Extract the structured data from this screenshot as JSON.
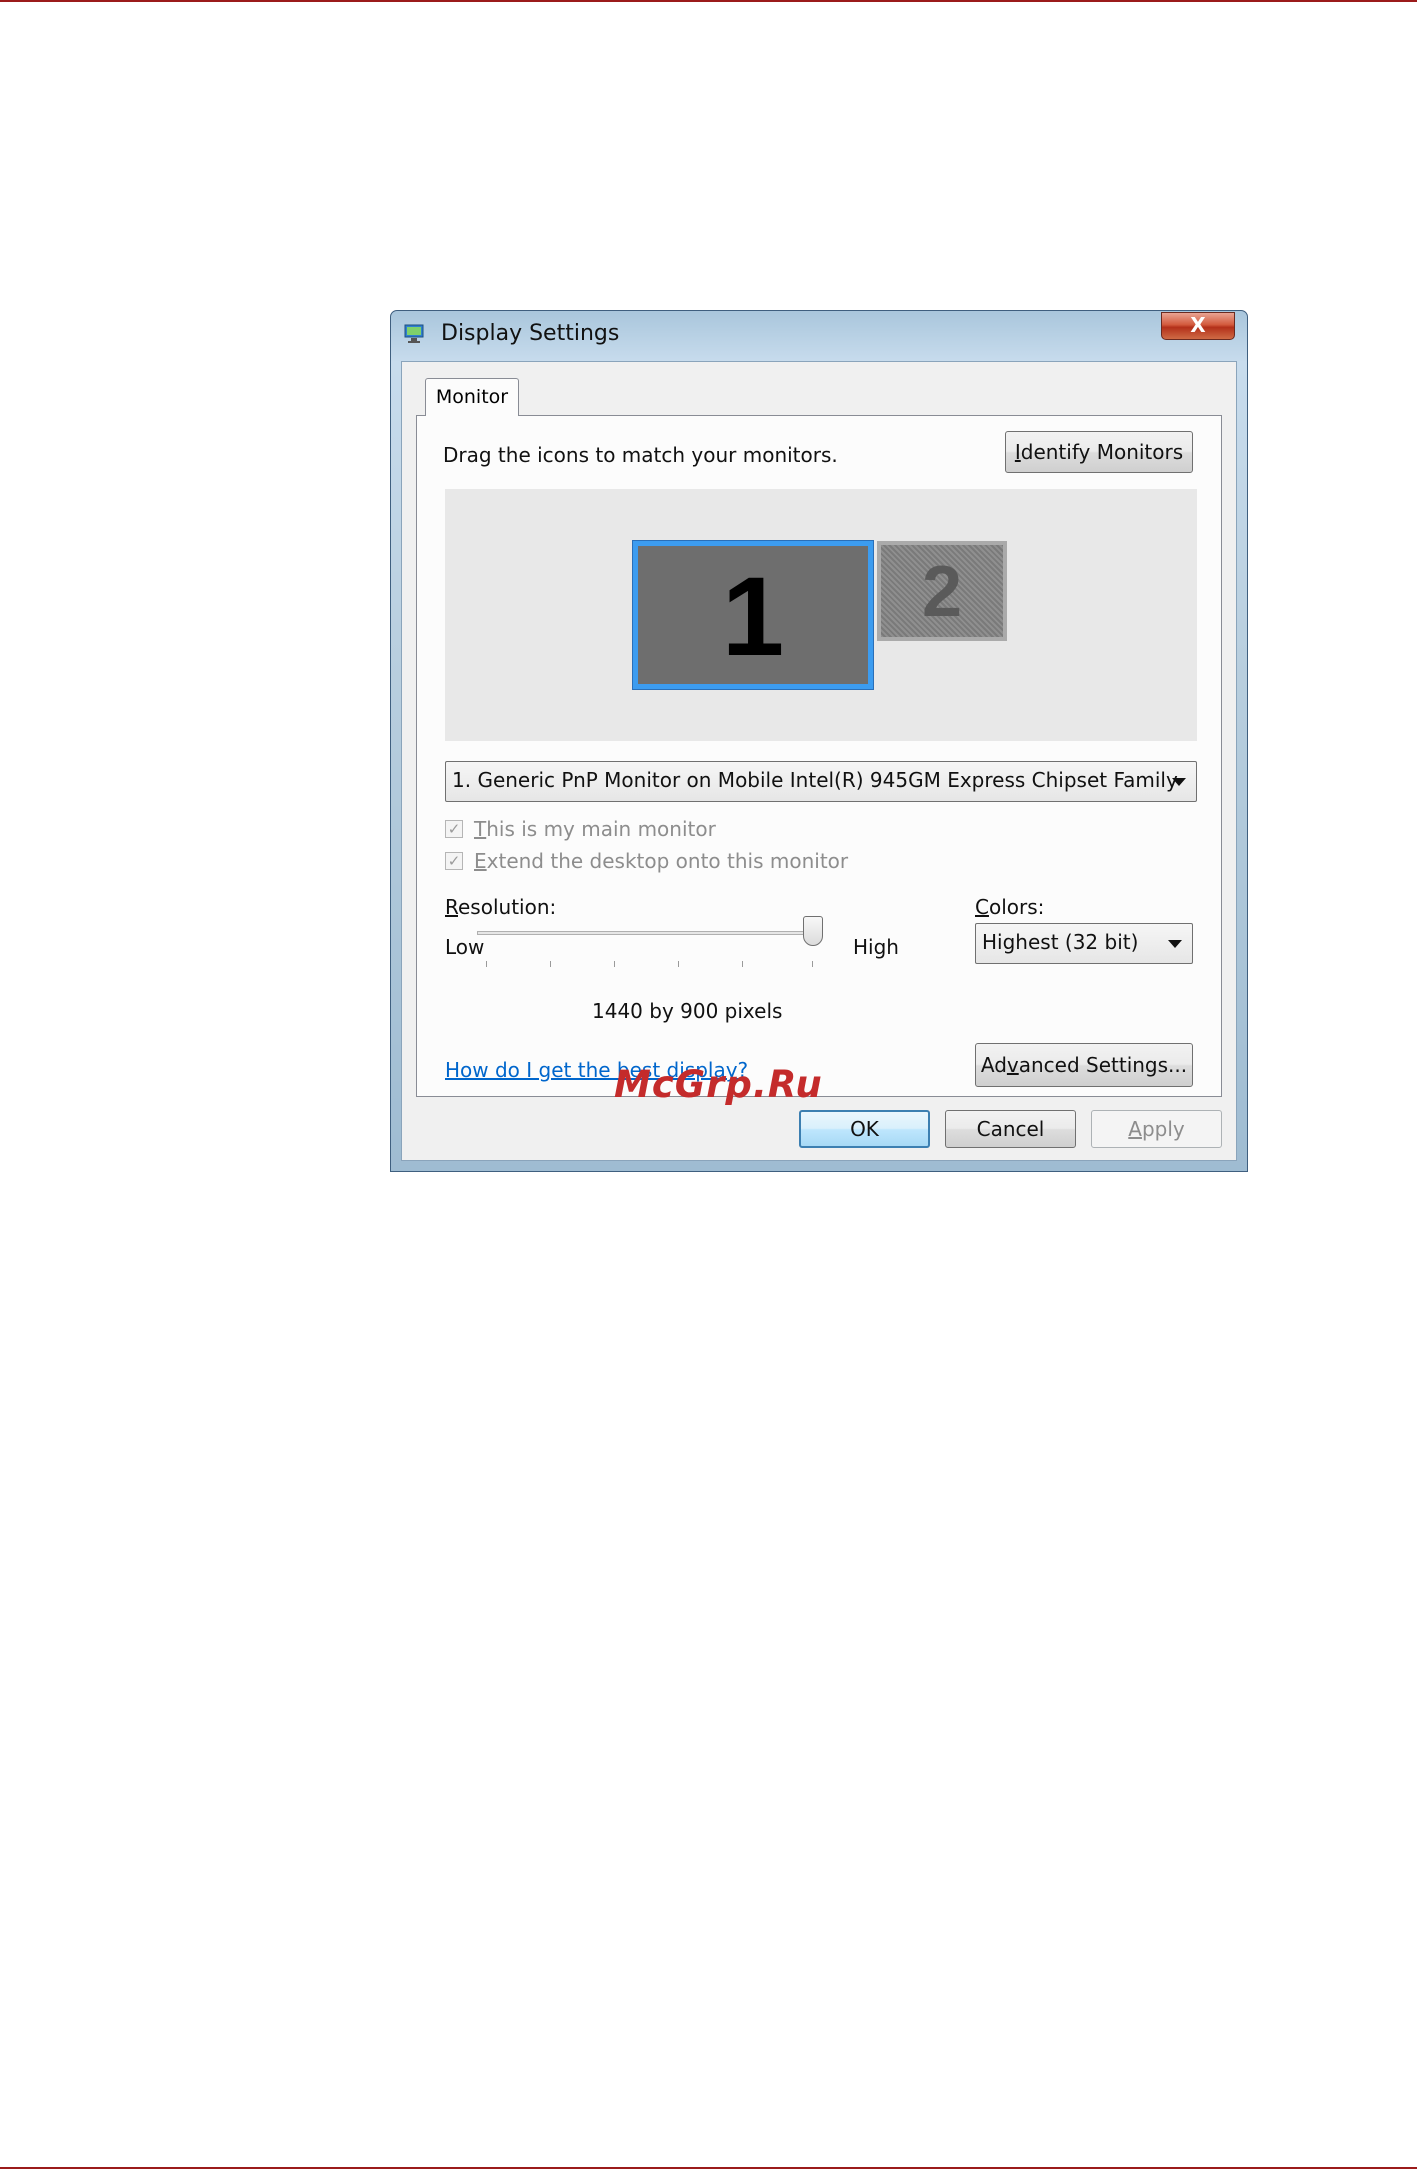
{
  "window": {
    "title": "Display Settings",
    "close_glyph": "X"
  },
  "tabs": [
    {
      "label": "Monitor"
    }
  ],
  "monitor_tab": {
    "instruction": "Drag the icons to match your monitors.",
    "identify_button": "Identify Monitors",
    "monitor_icons": [
      {
        "number": "1",
        "selected": true
      },
      {
        "number": "2",
        "selected": false
      }
    ],
    "monitor_select": {
      "value": "1. Generic PnP Monitor on Mobile Intel(R) 945GM Express Chipset Family"
    },
    "main_monitor_checkbox": {
      "label": "This is my main monitor",
      "checked": true,
      "enabled": false
    },
    "extend_desktop_checkbox": {
      "label": "Extend the desktop onto this monitor",
      "checked": true,
      "enabled": false
    },
    "resolution": {
      "label": "Resolution:",
      "low_label": "Low",
      "high_label": "High",
      "value_text": "1440 by 900 pixels",
      "slider_level": 1.0
    },
    "colors": {
      "label": "Colors:",
      "value": "Highest (32 bit)"
    },
    "help_link": "How do I get the best display?",
    "advanced_button": "Advanced Settings..."
  },
  "footer": {
    "ok_label": "OK",
    "cancel_label": "Cancel",
    "apply_label": "Apply"
  },
  "watermark": "McGrp.Ru",
  "colors_hex": {
    "accent_border": "#3c9cf0",
    "link": "#0066cc",
    "page_rule": "#9b1b1b"
  }
}
